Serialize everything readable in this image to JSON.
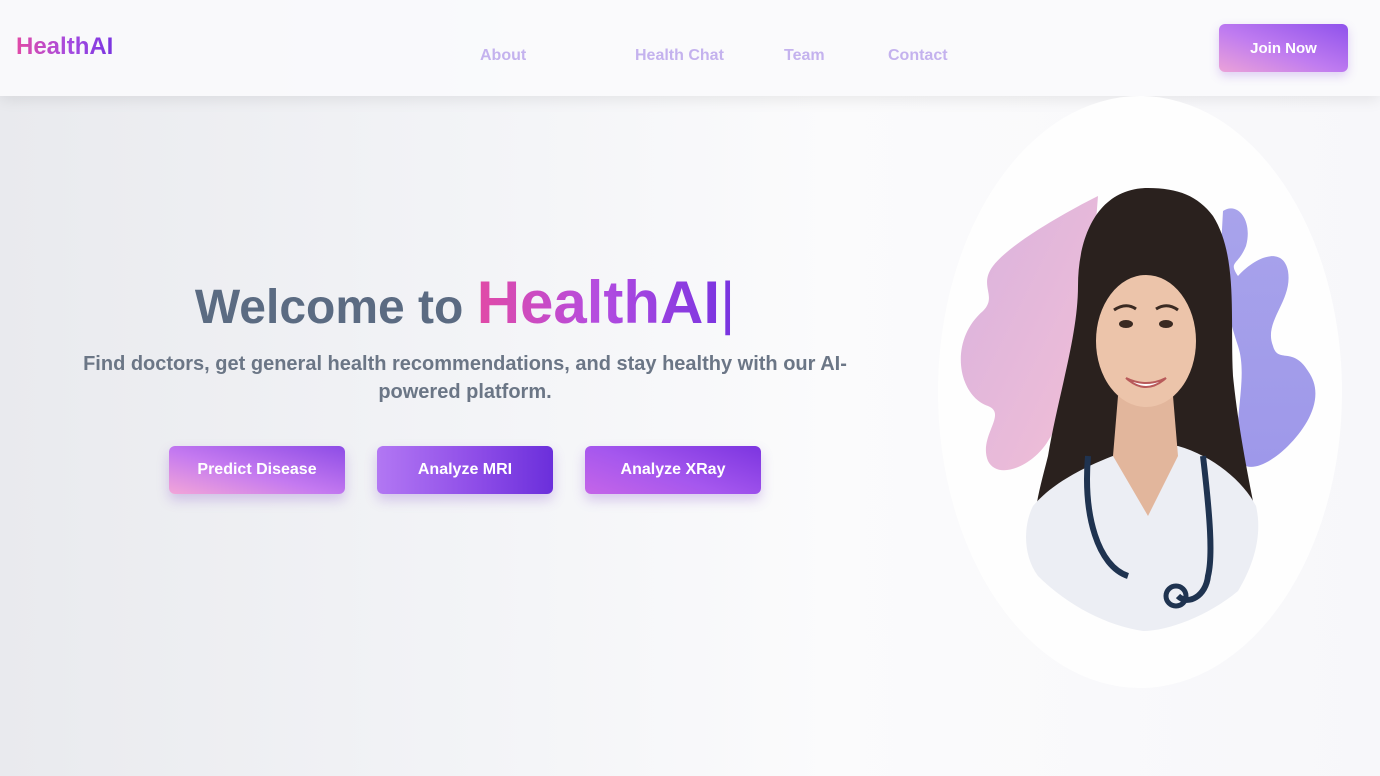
{
  "header": {
    "logo": "HealthAI",
    "nav": [
      {
        "label": "About"
      },
      {
        "label": "Health Chat"
      },
      {
        "label": "Team"
      },
      {
        "label": "Contact"
      }
    ],
    "cta_label": "Join Now"
  },
  "hero": {
    "title_prefix": "Welcome to",
    "title_brand": "HealthAI",
    "cursor": "|",
    "subtitle": "Find doctors, get general health recommendations, and stay healthy with our AI-powered platform.",
    "buttons": [
      {
        "label": "Predict Disease"
      },
      {
        "label": "Analyze MRI"
      },
      {
        "label": "Analyze XRay"
      }
    ]
  },
  "colors": {
    "brand_pink": "#e14aa6",
    "brand_purple": "#7b35e0",
    "nav_text": "#c4b2ee",
    "title_gray": "#5b6b82"
  }
}
